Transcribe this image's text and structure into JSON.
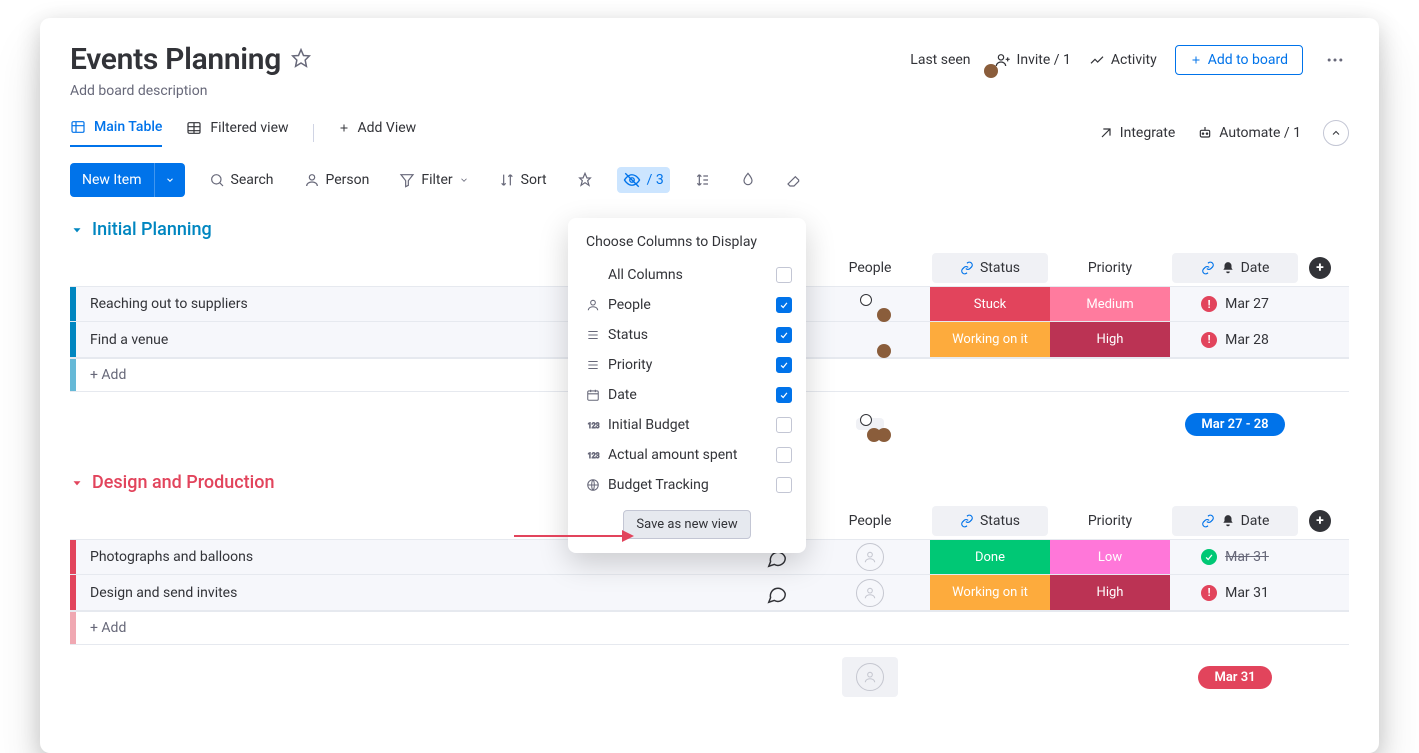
{
  "header": {
    "title": "Events Planning",
    "description": "Add board description",
    "last_seen": "Last seen",
    "invite": "Invite / 1",
    "activity": "Activity",
    "add_to_board": "Add to board"
  },
  "views": {
    "main_table": "Main Table",
    "filtered": "Filtered view",
    "add_view": "Add View",
    "integrate": "Integrate",
    "automate": "Automate / 1"
  },
  "toolbar": {
    "new_item": "New Item",
    "search": "Search",
    "person": "Person",
    "filter": "Filter",
    "sort": "Sort",
    "hide_count": "/ 3"
  },
  "columns": {
    "people": "People",
    "status": "Status",
    "priority": "Priority",
    "date": "Date"
  },
  "groups": [
    {
      "name": "Initial Planning",
      "color": "blue",
      "items": [
        {
          "name": "Reaching out to suppliers",
          "status": "Stuck",
          "status_color": "#e2445c",
          "priority": "Medium",
          "priority_color": "#ff7b9e",
          "date": "Mar 27",
          "date_state": "warn"
        },
        {
          "name": "Find a venue",
          "status": "Working on it",
          "status_color": "#fdab3d",
          "priority": "High",
          "priority_color": "#bb3354",
          "date": "Mar 28",
          "date_state": "warn"
        }
      ],
      "add_label": "+ Add",
      "summary_date": "Mar 27 - 28",
      "summary_color": "#0073ea"
    },
    {
      "name": "Design and Production",
      "color": "red",
      "items": [
        {
          "name": "Photographs and balloons",
          "status": "Done",
          "status_color": "#00c875",
          "priority": "Low",
          "priority_color": "#ff77d9",
          "date": "Mar 31",
          "date_state": "done"
        },
        {
          "name": "Design and send invites",
          "status": "Working on it",
          "status_color": "#fdab3d",
          "priority": "High",
          "priority_color": "#bb3354",
          "date": "Mar 31",
          "date_state": "warn"
        }
      ],
      "add_label": "+ Add",
      "summary_date": "Mar 31",
      "summary_color": "#e2445c"
    }
  ],
  "popover": {
    "title": "Choose Columns to Display",
    "items": [
      {
        "label": "All Columns",
        "icon": "none",
        "checked": false
      },
      {
        "label": "People",
        "icon": "people",
        "checked": true
      },
      {
        "label": "Status",
        "icon": "status",
        "checked": true
      },
      {
        "label": "Priority",
        "icon": "status",
        "checked": true
      },
      {
        "label": "Date",
        "icon": "calendar",
        "checked": true
      },
      {
        "label": "Initial Budget",
        "icon": "numbers",
        "checked": false
      },
      {
        "label": "Actual amount spent",
        "icon": "numbers",
        "checked": false
      },
      {
        "label": "Budget Tracking",
        "icon": "globe",
        "checked": false
      }
    ],
    "save": "Save as new view"
  }
}
